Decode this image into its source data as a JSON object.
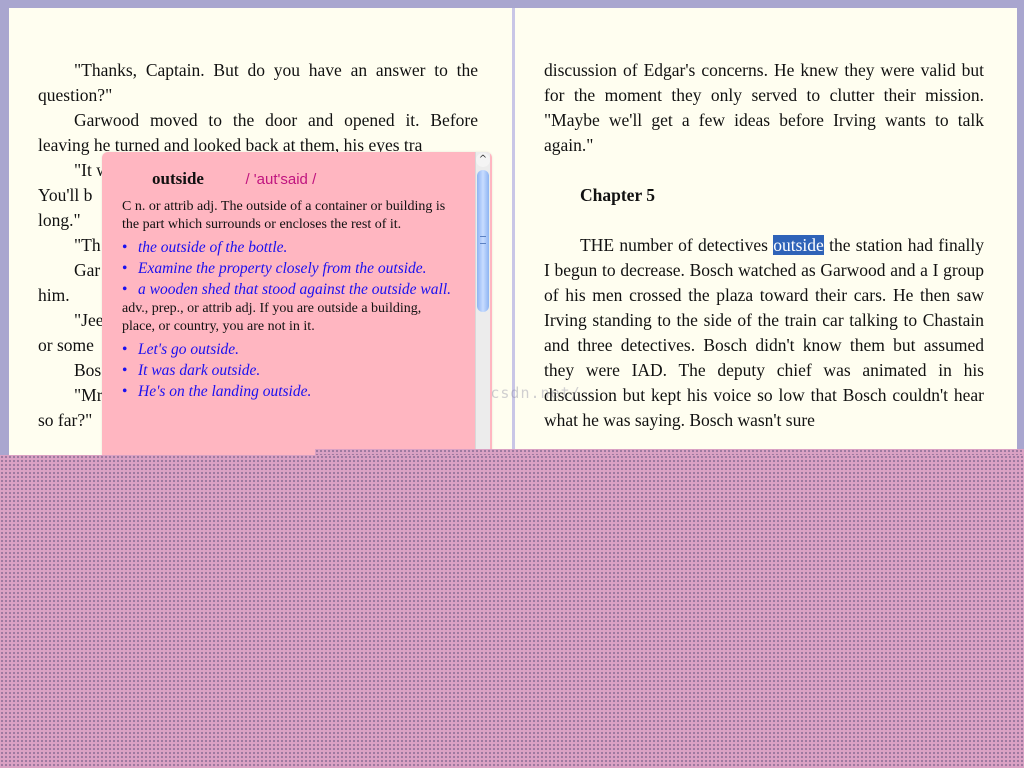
{
  "left_page": {
    "paragraphs": [
      "\"Thanks, Captain. But do you have an answer to the question?\"",
      "Garwood moved to the door and opened it. Before leaving he turned and looked back at them, his eyes tra",
      "\"It w",
      "You'll b",
      "long.\"",
      "\"Th",
      "Gar",
      "him.",
      "\"Jee",
      "or some",
      "Bos",
      "\"Mr",
      "so far?\""
    ]
  },
  "right_page": {
    "para1": "discussion of Edgar's concerns. He knew they were valid but for the moment they only served to clutter their mission. \"Maybe we'll get a few ideas before Irving wants to talk again.\"",
    "chapter_title": "Chapter 5",
    "para2_before": "THE number of detectives ",
    "para2_highlight": "outside",
    "para2_after": " the station had finally I begun to decrease. Bosch watched as Garwood and a I group of his men crossed the plaza toward their cars. He then saw Irving standing to the side of the train car talking to Chastain and three detectives. Bosch didn't know them but assumed they were IAD. The deputy chief was animated in his discussion but kept his voice so low that Bosch couldn't hear what he was saying. Bosch wasn't sure"
  },
  "dictionary": {
    "headword": "outside",
    "pronunciation": "/ 'aut'said /",
    "sense1_def": "C n. or attrib adj. The outside of a container or building is the part which surrounds or encloses the rest of it.",
    "sense1_examples": [
      "the outside of the bottle.",
      "Examine the property closely from the outside.",
      "a wooden shed that stood against the outside wall."
    ],
    "sense2_def": "adv., prep., or attrib adj. If you are outside a building, place, or country, you are not in it.",
    "sense2_examples": [
      "Let's go outside.",
      "It was dark outside.",
      "He's on the landing outside."
    ],
    "bullet": "•",
    "scroll_up": "^"
  },
  "watermark": "http://blog.csdn.net/",
  "colors": {
    "page_bg": "#fffef0",
    "frame_bg": "#a9a6cf",
    "popup_bg": "#ffb6c1",
    "example_text": "#1b10f0",
    "pronunciation": "#c0147f",
    "highlight": "#2f63b8",
    "overlay": "#dba2c4"
  }
}
